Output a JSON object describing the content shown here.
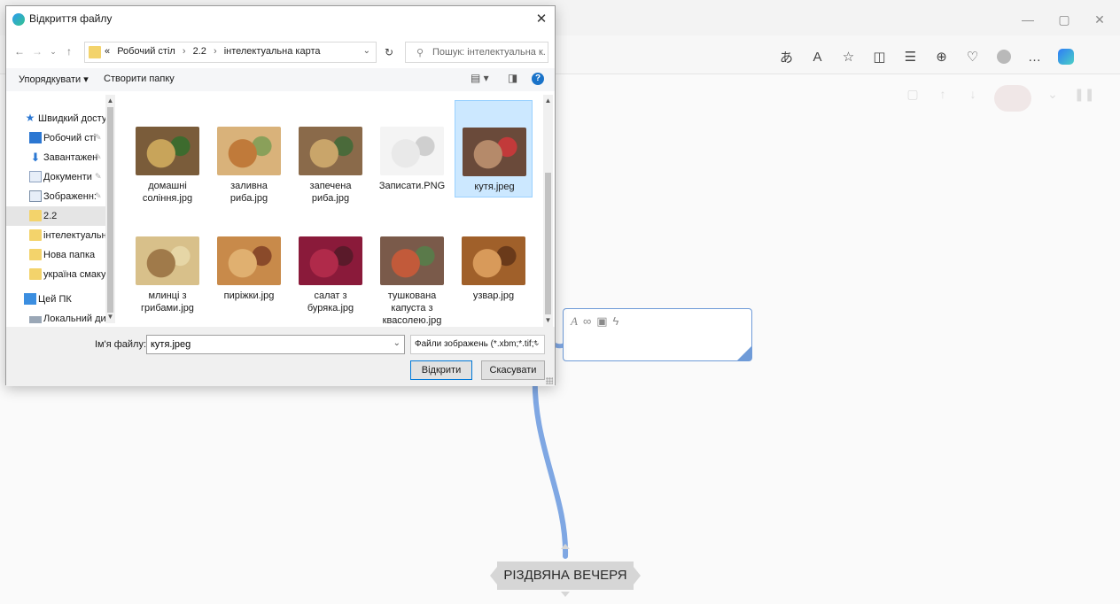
{
  "dialog": {
    "title": "Відкриття файлу",
    "close": "✕",
    "address": {
      "prefix": "«",
      "segments": [
        "Робочий стіл",
        "2.2",
        "інтелектуальна карта"
      ],
      "separator": "›"
    },
    "search_placeholder": "Пошук: інтелектуальна к...",
    "commands": {
      "organize": "Упорядкувати ▾",
      "new_folder": "Створити папку",
      "help": "?"
    },
    "tree": [
      {
        "label": "Швидкий доступ",
        "icon": "star-icon",
        "pinned": false
      },
      {
        "label": "Робочий сті",
        "icon": "desktop-icon",
        "pinned": true
      },
      {
        "label": "Завантажен",
        "icon": "download-icon",
        "pinned": true
      },
      {
        "label": "Документи",
        "icon": "documents-icon",
        "pinned": true
      },
      {
        "label": "Зображенн:",
        "icon": "pictures-icon",
        "pinned": true
      },
      {
        "label": "2.2",
        "icon": "folder-icon",
        "pinned": false,
        "selected": true
      },
      {
        "label": "інтелектуальна",
        "icon": "folder-icon",
        "pinned": false
      },
      {
        "label": "Нова папка",
        "icon": "folder-icon",
        "pinned": false
      },
      {
        "label": "україна смакує",
        "icon": "folder-icon",
        "pinned": false
      },
      {
        "label": "Цей ПК",
        "icon": "pc-icon",
        "pinned": false
      },
      {
        "label": "Локальний дис",
        "icon": "drive-icon",
        "pinned": false
      }
    ],
    "files": [
      {
        "name_lines": [
          "домашні",
          "соління.jpg"
        ],
        "colors": [
          "#7a5c3a",
          "#c8a45a",
          "#3d6b2e"
        ],
        "selected": false
      },
      {
        "name_lines": [
          "заливна",
          "риба.jpg"
        ],
        "colors": [
          "#d9b27a",
          "#c07a3a",
          "#8aa05a"
        ],
        "selected": false
      },
      {
        "name_lines": [
          "запечена",
          "риба.jpg"
        ],
        "colors": [
          "#8a6a4a",
          "#c9a56a",
          "#4a6a3a"
        ],
        "selected": false
      },
      {
        "name_lines": [
          "Записати.PNG"
        ],
        "colors": [
          "#f4f4f4",
          "#e9e9e9",
          "#cfcfcf"
        ],
        "selected": false
      },
      {
        "name_lines": [
          "кутя.jpeg"
        ],
        "colors": [
          "#6a4a3a",
          "#b58a6a",
          "#c23a3a"
        ],
        "selected": true
      },
      {
        "name_lines": [
          "млинці з",
          "грибами.jpg"
        ],
        "colors": [
          "#d8c08a",
          "#a07a4a",
          "#e6d6a6"
        ],
        "selected": false
      },
      {
        "name_lines": [
          "пиріжки.jpg"
        ],
        "colors": [
          "#c88a4a",
          "#e0b070",
          "#8a4a2a"
        ],
        "selected": false
      },
      {
        "name_lines": [
          "салат з",
          "буряка.jpg"
        ],
        "colors": [
          "#8a1a3a",
          "#b02a4a",
          "#5a1a2a"
        ],
        "selected": false
      },
      {
        "name_lines": [
          "тушкована",
          "капуста з",
          "квасолею.jpg"
        ],
        "colors": [
          "#7a5a4a",
          "#c25a3a",
          "#5a7a4a"
        ],
        "selected": false
      },
      {
        "name_lines": [
          "узвар.jpg"
        ],
        "colors": [
          "#a0602a",
          "#d89a5a",
          "#6a3a1a"
        ],
        "selected": false
      }
    ],
    "filename_label": "Ім'я файлу:",
    "filename_value": "кутя.jpeg",
    "filter_value": "Файли зображень (*.xbm;*.tif;*",
    "open_button": "Відкрити",
    "cancel_button": "Скасувати"
  },
  "mindmap": {
    "root_label": "РІЗДВЯНА ВЕЧЕРЯ",
    "branch_color": "#7fa7e3"
  },
  "browser": {
    "toolbar_icons": [
      "translate-icon",
      "read-aloud-icon",
      "favorite-icon",
      "split-screen-icon",
      "favorites-list-icon",
      "collections-icon",
      "health-icon",
      "profile-icon",
      "more-icon",
      "copilot-icon"
    ]
  }
}
